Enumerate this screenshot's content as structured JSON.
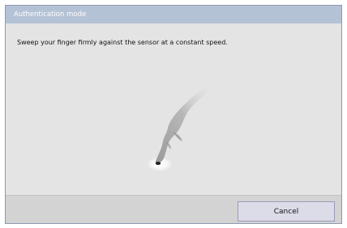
{
  "window": {
    "title": "Authentication mode"
  },
  "content": {
    "instruction": "Sweep your finger firmly against the sensor at a constant speed.",
    "illustration": {
      "icon": "finger-sweep-icon"
    }
  },
  "footer": {
    "cancel_label": "Cancel"
  },
  "colors": {
    "titlebar": "#b4c2d6",
    "content_background": "#e4e4e4",
    "footer_background": "#d3d3d3",
    "button_background": "#dcdce8"
  }
}
